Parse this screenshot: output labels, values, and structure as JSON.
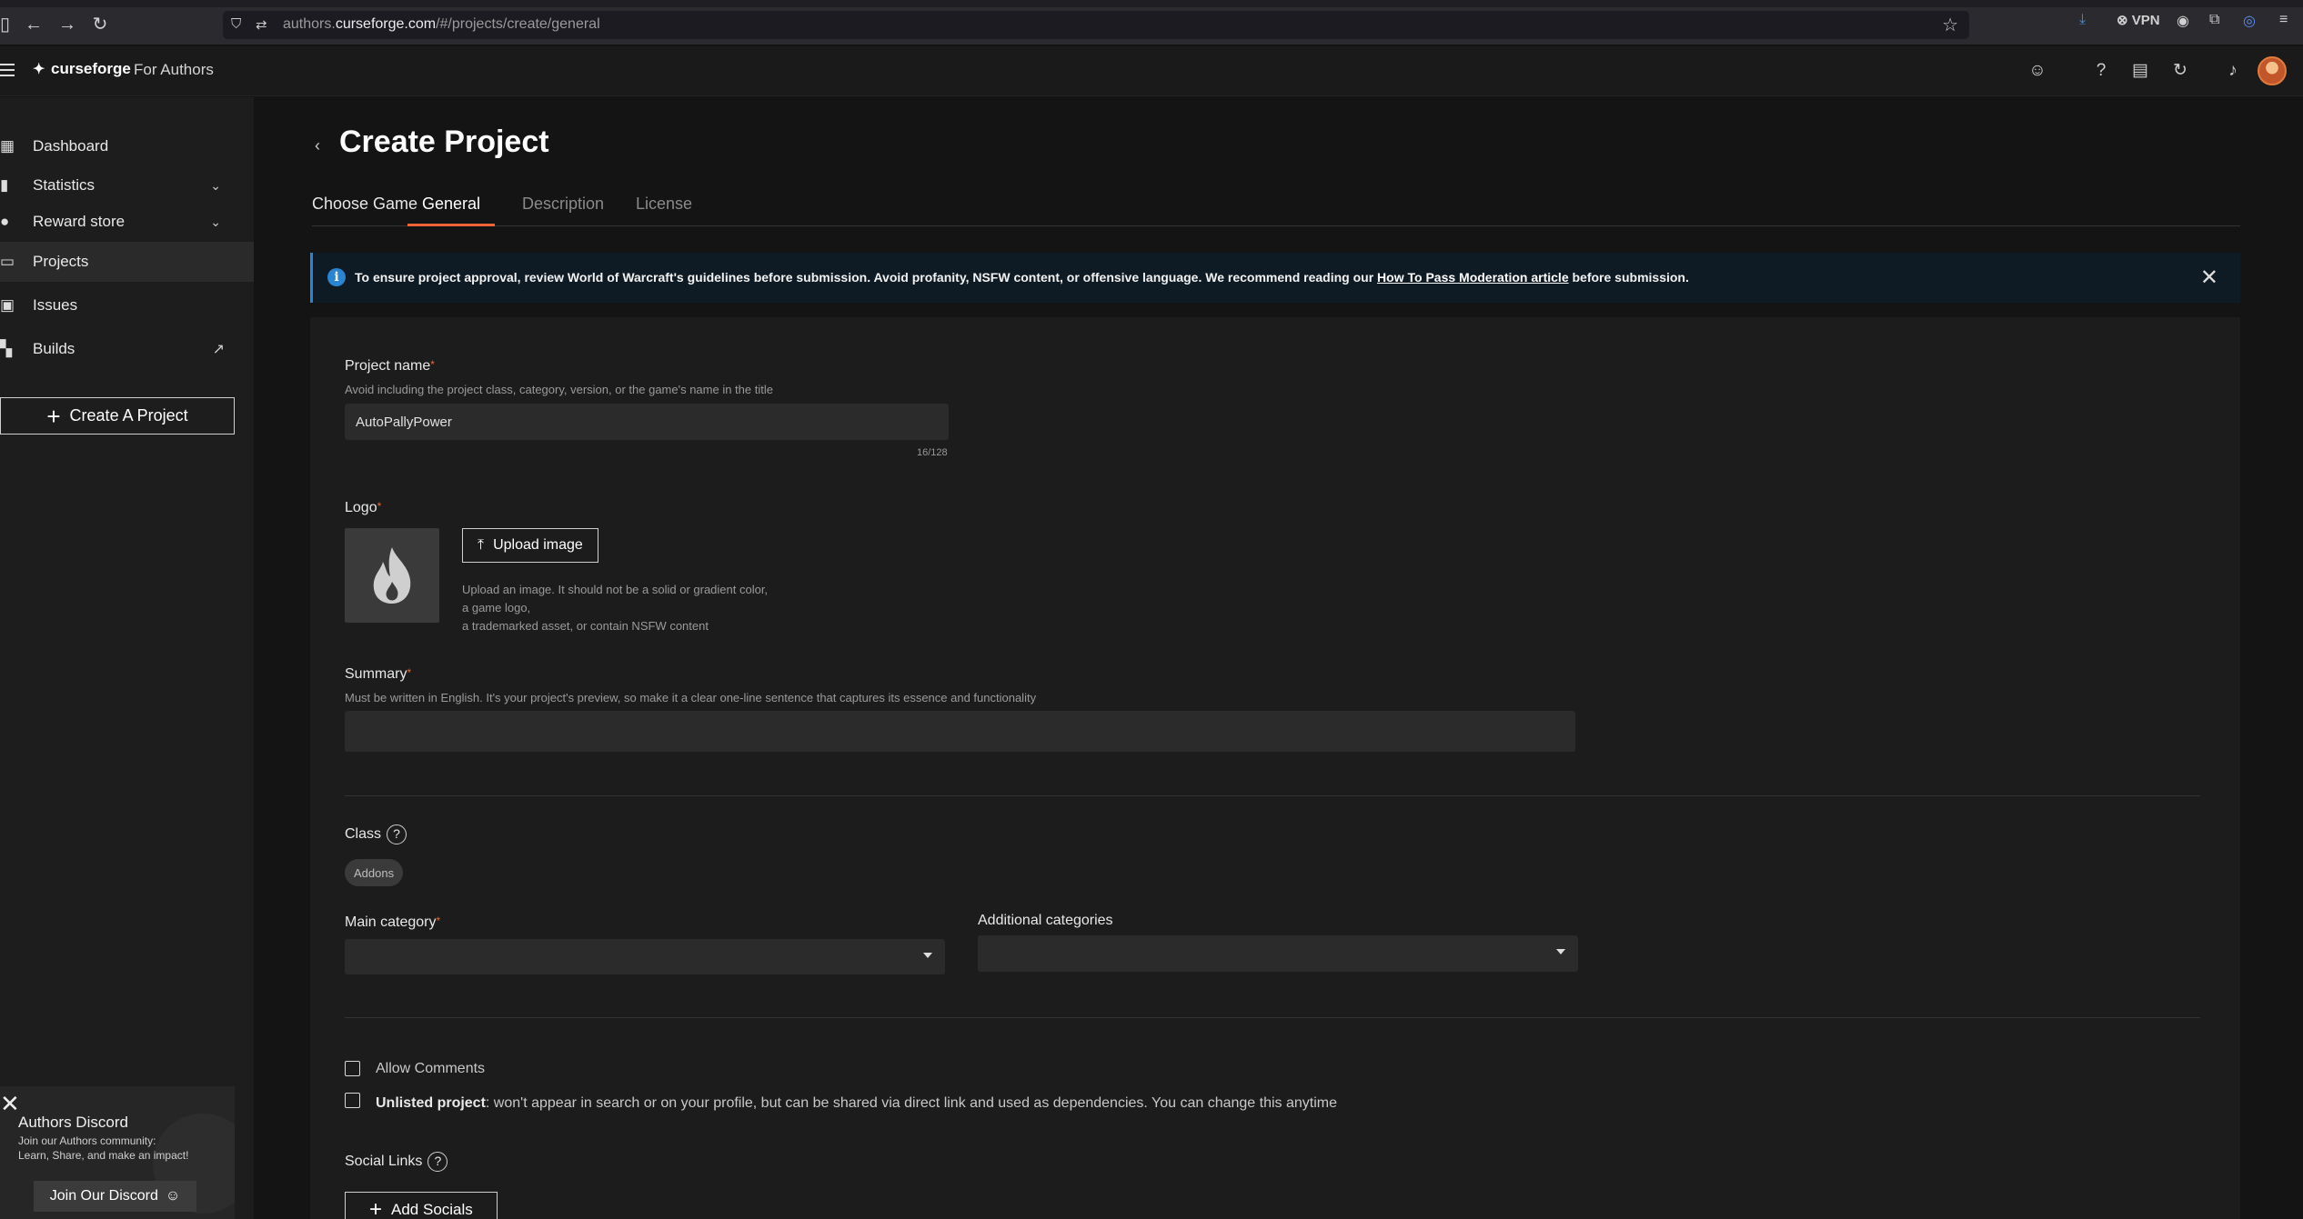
{
  "browser": {
    "url_host_prefix": "authors.",
    "url_host_domain": "curseforge.com",
    "url_path": "/#/projects/create/general",
    "vpn_label": "VPN"
  },
  "appbar": {
    "logo_text": "curseforge",
    "subtitle": "For Authors"
  },
  "sidebar": {
    "items": [
      {
        "label": "Dashboard"
      },
      {
        "label": "Statistics"
      },
      {
        "label": "Reward store"
      },
      {
        "label": "Projects"
      },
      {
        "label": "Issues"
      },
      {
        "label": "Builds"
      }
    ],
    "create_label": "Create A Project",
    "discord": {
      "title": "Authors Discord",
      "line1": "Join our Authors community:",
      "line2": "Learn, Share, and make an impact!",
      "button": "Join Our Discord"
    }
  },
  "page": {
    "title": "Create Project",
    "tabs": [
      {
        "label": "Choose Game"
      },
      {
        "label": "General"
      },
      {
        "label": "Description"
      },
      {
        "label": "License"
      }
    ]
  },
  "banner": {
    "text_before": "To ensure project approval, review World of Warcraft's guidelines before submission. Avoid profanity, NSFW content, or offensive language. We recommend reading our ",
    "link": "How To Pass Moderation article",
    "text_after": " before submission."
  },
  "form": {
    "project_name": {
      "label": "Project name",
      "hint": "Avoid including the project class, category, version, or the game's name in the title",
      "value": "AutoPallyPower",
      "counter": "16/128"
    },
    "logo": {
      "label": "Logo",
      "upload_label": "Upload image",
      "hint1": "Upload an image. It should not be a solid or gradient color,",
      "hint2": "a game logo,",
      "hint3": "a trademarked asset, or contain NSFW content"
    },
    "summary": {
      "label": "Summary",
      "hint": "Must be written in English. It's your project's preview, so make it a clear one-line sentence that captures its essence and functionality",
      "value": ""
    },
    "class": {
      "label": "Class",
      "chip": "Addons"
    },
    "main_category": {
      "label": "Main category",
      "value": ""
    },
    "additional_categories": {
      "label": "Additional categories",
      "value": ""
    },
    "allow_comments": {
      "label": "Allow Comments",
      "checked": false
    },
    "unlisted": {
      "bold": "Unlisted project",
      "text": ": won't appear in search or on your profile, but can be shared via direct link and used as dependencies. You can change this anytime",
      "checked": false
    },
    "social_links": {
      "label": "Social Links",
      "button": "Add Socials"
    }
  },
  "colors": {
    "accent": "#f16436",
    "info": "#2a84d2"
  }
}
